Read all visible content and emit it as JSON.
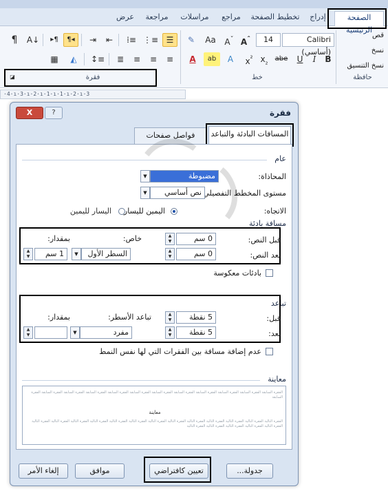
{
  "ribbon": {
    "tabs": [
      {
        "label": "الصفحة الرئيسية",
        "active": true
      },
      {
        "label": "إدراج",
        "active": false
      },
      {
        "label": "تخطيط الصفحة",
        "active": false
      },
      {
        "label": "مراجع",
        "active": false
      },
      {
        "label": "مراسلات",
        "active": false
      },
      {
        "label": "مراجعة",
        "active": false
      },
      {
        "label": "عرض",
        "active": false
      }
    ],
    "clipboard": {
      "cut": "قص",
      "copy": "نسخ",
      "format_painter": "نسخ التنسيق",
      "group_label": "حافظة"
    },
    "font": {
      "name": "Calibri (أساسي)",
      "size": "14",
      "group_label": "خط"
    },
    "paragraph": {
      "group_label": "فقرة"
    },
    "ruler_text": "·4·ı·3·ı·2·ı·1·ı·1·ı·2·ı·3"
  },
  "dialog": {
    "title": "فقرة",
    "close_label": "X",
    "help_label": "?",
    "tabs": [
      {
        "label": "المسافات البادئة والتباعد",
        "active": true
      },
      {
        "label": "فواصل صفحات وأسطر",
        "active": false
      }
    ],
    "general": {
      "section": "عام",
      "alignment_label": "المحاذاة:",
      "alignment_value": "مضبوطة",
      "outline_label": "مستوى المخطط التفصيلي:",
      "outline_value": "نص أساسي",
      "direction_label": "الاتجاه:",
      "rtl_label": "اليمين لليسار",
      "ltr_label": "اليسار لليمين"
    },
    "indentation": {
      "section": "مسافة بادئة",
      "before_label": "قبل النص:",
      "before_value": "0 سم",
      "after_label": "بعد النص:",
      "after_value": "0 سم",
      "special_label": "خاص:",
      "special_value": "السطر الأول",
      "by_label": "بمقدار:",
      "by_value": "1 سم",
      "mirror_label": "بادئات معكوسة"
    },
    "spacing": {
      "section": "تباعد",
      "before_label": "قبل:",
      "before_value": "5 نقطة",
      "after_label": "بعد:",
      "after_value": "5 نقطة",
      "line_label": "تباعد الأسطر:",
      "line_value": "مفرد",
      "at_label": "بمقدار:",
      "at_value": "",
      "dont_add_label": "عدم إضافة مسافة بين الفقرات التي لها نفس النمط"
    },
    "preview": {
      "section": "معاينة",
      "prev_text": "الفقرة السابقة الفقرة السابقة الفقرة السابقة الفقرة السابقة الفقرة السابقة الفقرة السابقة الفقرة السابقة الفقرة السابقة الفقرة السابقة الفقرة السابقة الفقرة السابقة الفقرة السابقة",
      "sample": "معاينة",
      "next_text": "الفقرة التالية الفقرة التالية الفقرة التالية الفقرة التالية الفقرة التالية الفقرة التالية الفقرة التالية الفقرة التالية الفقرة التالية الفقرة التالية الفقرة التالية الفقرة التالية الفقرة التالية الفقرة التالية الفقرة التالية الفقرة التالية الفقرة التالية الفقرة التالية"
    },
    "buttons": {
      "tabs": "جدولة...",
      "set_default": "تعيين كافتراضي",
      "ok": "موافق",
      "cancel": "إلغاء الأمر"
    }
  },
  "colors": {
    "highlight_outline": "#000000",
    "selection": "#3a6fd8",
    "dialog_bg": "#d9e4f2"
  }
}
